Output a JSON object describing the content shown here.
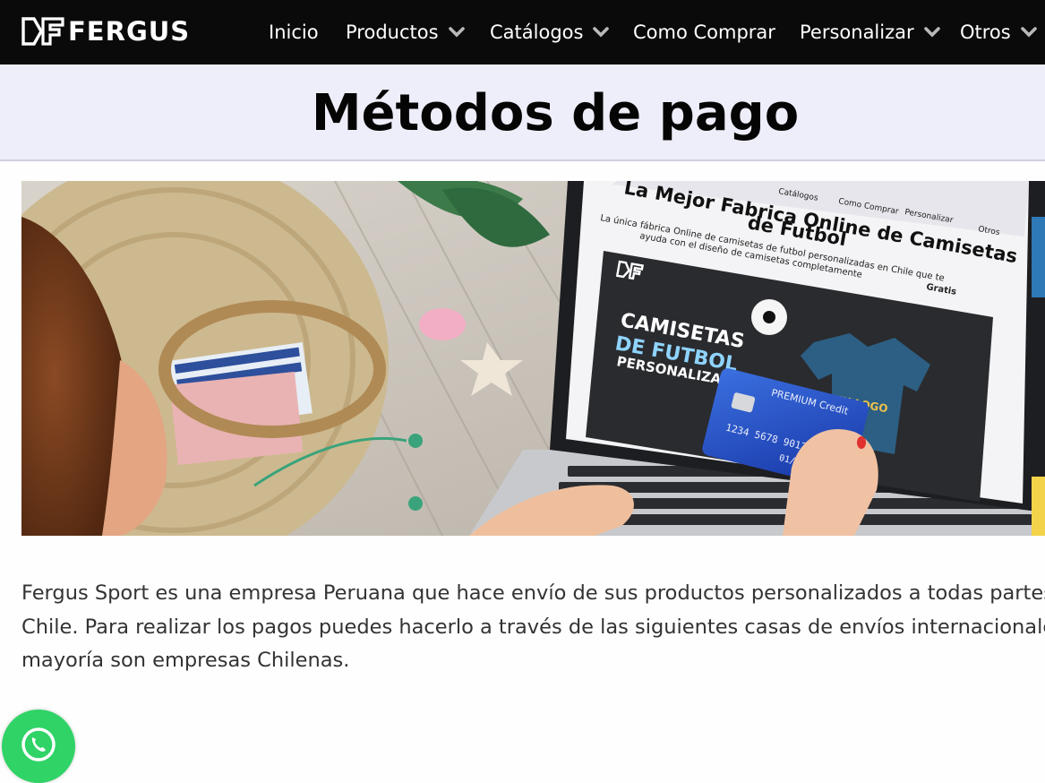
{
  "brand": {
    "name": "FERGUS",
    "logo_icon": "fergus-f-logo"
  },
  "nav": {
    "items": [
      {
        "label": "Inicio",
        "dropdown": false
      },
      {
        "label": "Productos",
        "dropdown": true
      },
      {
        "label": "Catálogos",
        "dropdown": true
      },
      {
        "label": "Como Comprar",
        "dropdown": false
      },
      {
        "label": "Personalizar",
        "dropdown": true
      },
      {
        "label": "Otros",
        "dropdown": true
      }
    ]
  },
  "page": {
    "title": "Métodos de pago"
  },
  "hero": {
    "screen": {
      "menu": [
        "Catálogos",
        "Como Comprar",
        "Personalizar",
        "Otros"
      ],
      "headline_1": "La Mejor Fabrica Online de Camisetas",
      "headline_2": "de Futbol",
      "sub_1": "La única fábrica Online de camisetas de futbol personalizadas en Chile que te",
      "sub_2": "ayuda con el diseño de camisetas completamente",
      "sub_bold": "Gratis",
      "banner_1": "CAMISETAS",
      "banner_2": "DE FUTBOL",
      "banner_3": "PERSONALIZADAS",
      "shirt_text": "TU LOGO"
    },
    "card": {
      "brand": "PREMIUM Credit",
      "number": "1234 5678 9012 3",
      "expiry": "01/20"
    }
  },
  "intro": {
    "line1": "Fergus Sport es una empresa Peruana que hace envío de sus productos personalizados a todas partes de",
    "line2": "Chile. Para realizar los pagos puedes hacerlo a través de las siguientes casas de envíos internacionales, la",
    "line3": "mayoría son empresas Chilenas."
  },
  "colors": {
    "nav_bg": "#0a0a0a",
    "title_band": "#eeeefa",
    "whatsapp": "#2fd366",
    "text": "#333333"
  },
  "icons": {
    "dropdown": "chevron-down-icon",
    "whatsapp": "whatsapp-icon"
  }
}
